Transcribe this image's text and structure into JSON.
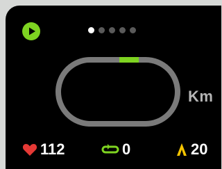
{
  "workout": {
    "active_page_index": 0,
    "page_count": 5,
    "track": {
      "unit": "Km",
      "progress_color": "#7ed321",
      "track_color": "#7a7a7a"
    },
    "stats": {
      "heart_rate": {
        "value": "112",
        "icon": "heart-icon",
        "color": "#e53935"
      },
      "laps": {
        "value": "0",
        "icon": "lap-loop-icon",
        "color": "#7ed321"
      },
      "elevation": {
        "value": "20",
        "icon": "elevation-flame-icon",
        "color": "#f5c400"
      }
    },
    "play_button": {
      "icon": "play-icon",
      "color": "#7ed321"
    }
  }
}
